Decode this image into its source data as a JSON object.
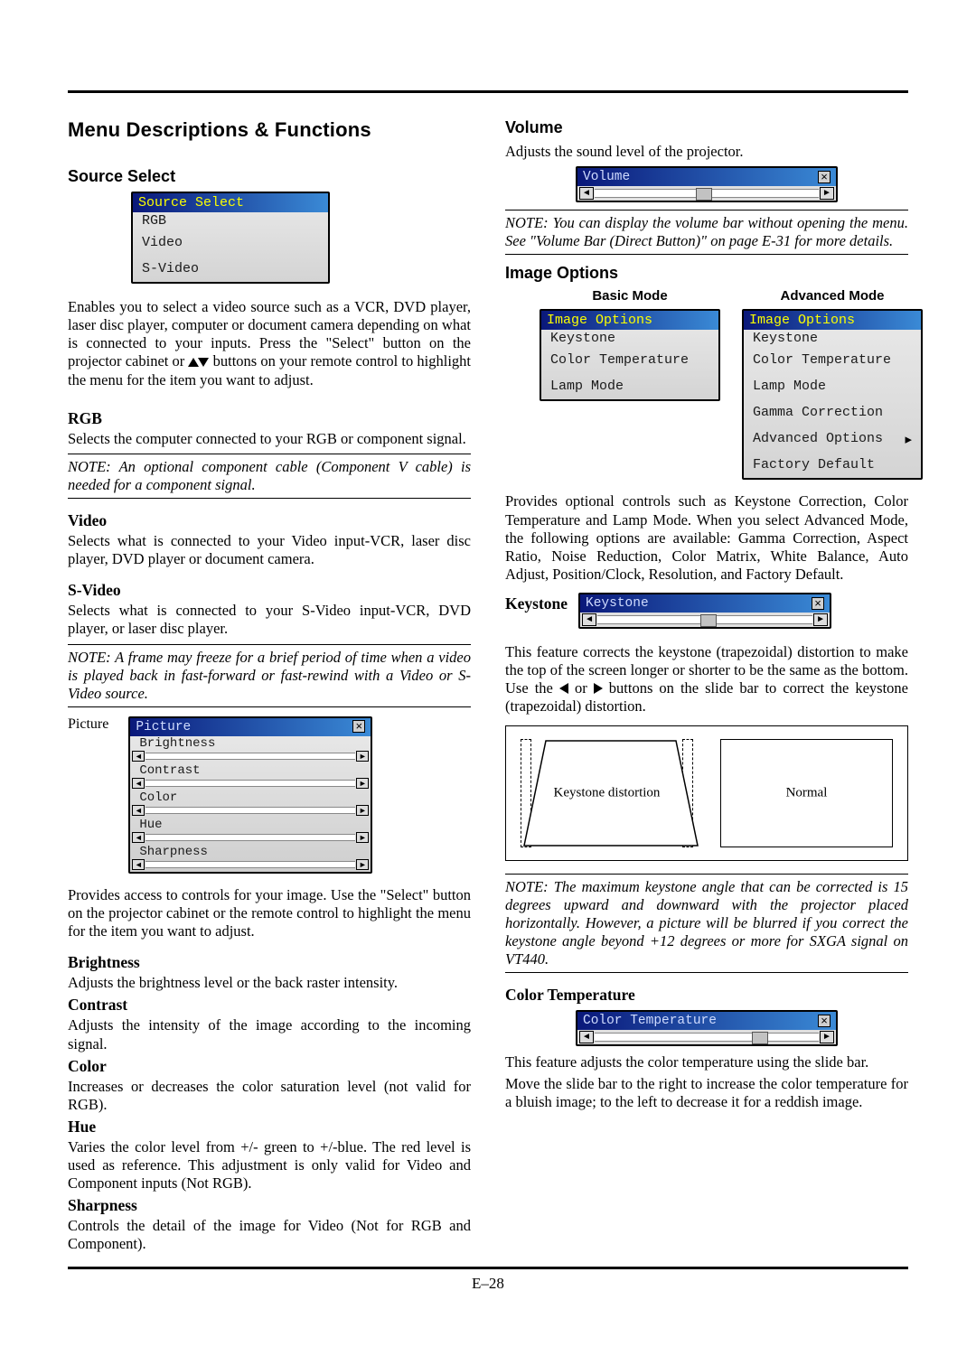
{
  "page_number": "E–28",
  "left": {
    "title": "Menu Descriptions & Functions",
    "source_select": {
      "heading": "Source Select",
      "menu_title": "Source Select",
      "items": [
        "RGB",
        "Video",
        "S-Video"
      ],
      "desc": "Enables you to select a video source such as a VCR, DVD player, laser disc player, computer or document camera depending on what is connected to your inputs. Press the \"Select\" button on the projector cabinet or ▲▼ buttons on your remote control to highlight the menu for the item you want to adjust."
    },
    "rgb": {
      "heading": "RGB",
      "desc": "Selects the computer connected to your RGB or component signal.",
      "note": "NOTE: An optional component cable (Component V cable) is needed for a component signal."
    },
    "video": {
      "heading": "Video",
      "desc": "Selects what is connected to your Video input-VCR, laser disc player, DVD player or document camera."
    },
    "svideo": {
      "heading": "S-Video",
      "desc": "Selects what is connected to your S-Video input-VCR, DVD player, or laser disc player.",
      "note": "NOTE: A frame may freeze for a brief period of time when a video is played back in fast-forward or fast-rewind with a Video or S-Video source."
    },
    "picture": {
      "heading": "Picture",
      "panel_title": "Picture",
      "rows": [
        "Brightness",
        "Contrast",
        "Color",
        "Hue",
        "Sharpness"
      ],
      "desc": "Provides access to controls for your image. Use the \"Select\" button on the projector cabinet or the remote control to highlight the menu for the item you want to adjust.",
      "brightness": {
        "h": "Brightness",
        "t": "Adjusts the brightness level or the back raster intensity."
      },
      "contrast": {
        "h": "Contrast",
        "t": "Adjusts the intensity of the image according to the incoming signal."
      },
      "color": {
        "h": "Color",
        "t": "Increases or decreases the color saturation level (not valid for RGB)."
      },
      "hue": {
        "h": "Hue",
        "t": "Varies the color level from +/- green to +/-blue. The red level is used as reference. This adjustment is only valid for Video and Component inputs (Not RGB)."
      },
      "sharpness": {
        "h": "Sharpness",
        "t": "Controls the detail of the image for Video (Not for RGB and Component)."
      }
    }
  },
  "right": {
    "volume": {
      "heading": "Volume",
      "desc": "Adjusts the sound level of the projector.",
      "panel_title": "Volume",
      "note": "NOTE: You can display the volume bar without opening the menu. See \"Volume Bar (Direct Button)\" on page E-31 for more details."
    },
    "image_options": {
      "heading": "Image Options",
      "basic_head": "Basic Mode",
      "advanced_head": "Advanced Mode",
      "panel_title": "Image Options",
      "basic_items": [
        "Keystone",
        "Color Temperature",
        "Lamp Mode"
      ],
      "advanced_items": [
        "Keystone",
        "Color Temperature",
        "Lamp Mode",
        "Gamma Correction",
        "Advanced Options",
        "Factory Default"
      ],
      "desc": "Provides optional controls such as Keystone Correction, Color Temperature and Lamp Mode. When you select Advanced Mode, the following options are available: Gamma Correction, Aspect Ratio, Noise Reduction, Color Matrix, White Balance, Auto Adjust, Position/Clock, Resolution, and Factory Default."
    },
    "keystone": {
      "heading": "Keystone",
      "panel_title": "Keystone",
      "desc_pre": "This feature corrects the keystone (trapezoidal) distortion to make the top of the screen longer or shorter to be the same as the bottom. Use the ",
      "desc_mid": " or ",
      "desc_post": " buttons on the slide bar to correct the keystone (trapezoidal) distortion.",
      "diag_left": "Keystone distortion",
      "diag_right": "Normal",
      "note": "NOTE: The maximum keystone angle that can be corrected is 15 degrees upward and downward with the projector placed horizontally. However, a picture will be blurred if you correct the keystone angle beyond +12 degrees or more for SXGA signal on VT440."
    },
    "color_temperature": {
      "heading": "Color Temperature",
      "panel_title": "Color Temperature",
      "desc1": "This feature adjusts the color temperature using the slide bar.",
      "desc2": "Move the slide bar to the right to increase the color temperature for a bluish image; to the left to decrease it for a reddish image."
    }
  }
}
